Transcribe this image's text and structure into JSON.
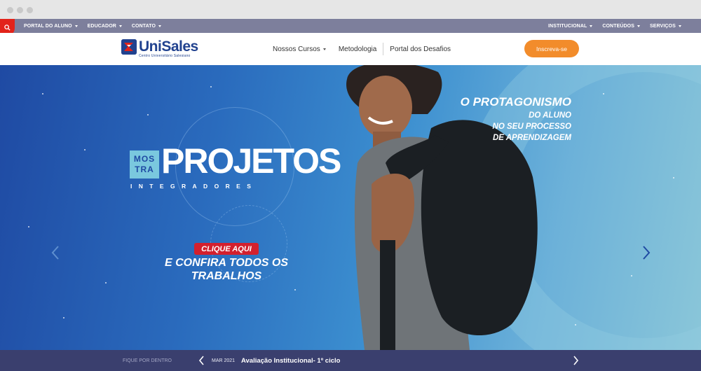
{
  "topbar": {
    "left_links": [
      {
        "label": "PORTAL DO ALUNO"
      },
      {
        "label": "EDUCADOR"
      },
      {
        "label": "CONTATO"
      }
    ],
    "right_links": [
      {
        "label": "INSTITUCIONAL"
      },
      {
        "label": "CONTEÚDOS"
      },
      {
        "label": "SERVIÇOS"
      }
    ]
  },
  "header": {
    "logo_name": "UniSales",
    "logo_sub": "Centro Universitário Salesiano",
    "nav": [
      {
        "label": "Nossos Cursos",
        "has_dropdown": true
      },
      {
        "label": "Metodologia"
      },
      {
        "label": "Portal dos Desafios"
      }
    ],
    "cta_label": "Inscreva-se"
  },
  "hero": {
    "mostra_line1": "MOS",
    "mostra_line2": "TRA",
    "projetos": "PROJETOS",
    "integradores": "INTEGRADORES",
    "clique": "CLIQUE AQUI",
    "confira": "E CONFIRA TODOS OS TRABALHOS",
    "protag_title": "O PROTAGONISMO",
    "protag_line1": "DO ALUNO",
    "protag_line2": "NO SEU PROCESSO",
    "protag_line3": "DE APRENDIZAGEM"
  },
  "news": {
    "label": "FIQUE POR DENTRO",
    "date": "MAR 2021",
    "title": "Avaliação Institucional- 1º ciclo"
  },
  "colors": {
    "brand_blue": "#21428f",
    "cta_orange": "#f28c2b",
    "search_red": "#e2231a",
    "topbar": "#7d7f9c",
    "bottombar": "#3a3f6e"
  }
}
